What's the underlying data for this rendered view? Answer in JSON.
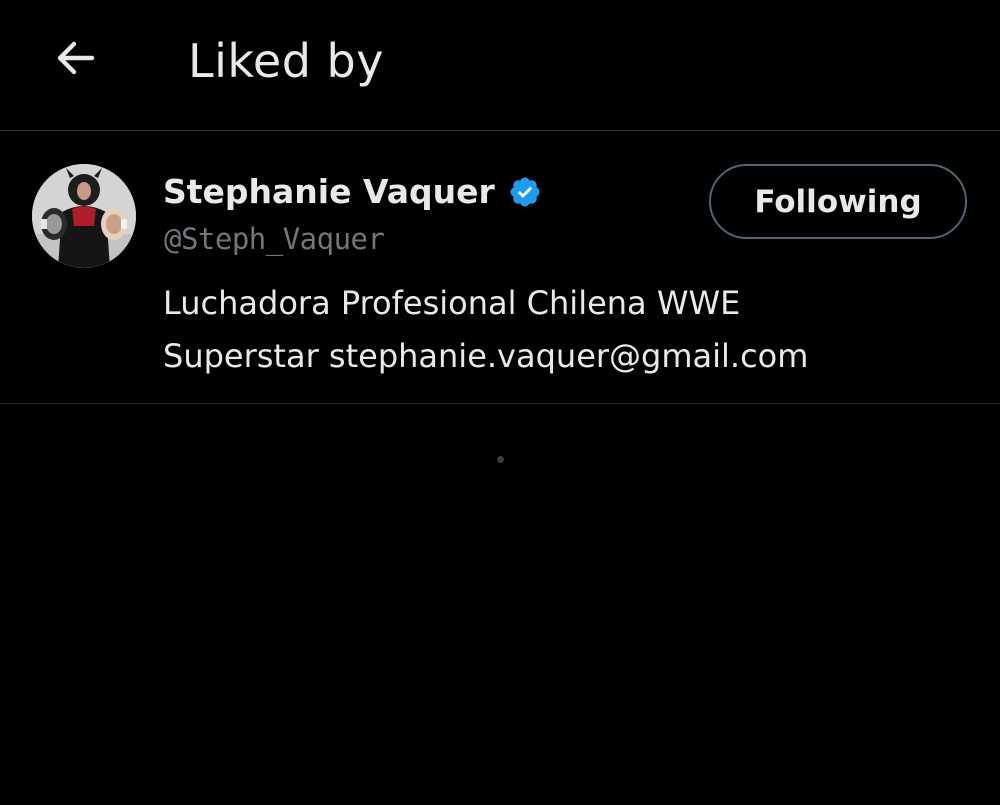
{
  "header": {
    "back_icon": "arrow-left-icon",
    "title": "Liked by"
  },
  "users": [
    {
      "display_name": "Stephanie Vaquer",
      "verified": true,
      "verified_icon": "verified-badge-icon",
      "verified_color": "#1d9bf0",
      "handle": "@Steph_Vaquer",
      "follow_label": "Following",
      "bio_lines": [
        "Luchadora Profesional Chilena WWE",
        "Superstar stephanie.vaquer@gmail.com"
      ]
    }
  ],
  "colors": {
    "background": "#000000",
    "primary_text": "#e7e9ea",
    "secondary_text": "#71767b",
    "divider": "#2f3336",
    "button_border": "#536471"
  }
}
